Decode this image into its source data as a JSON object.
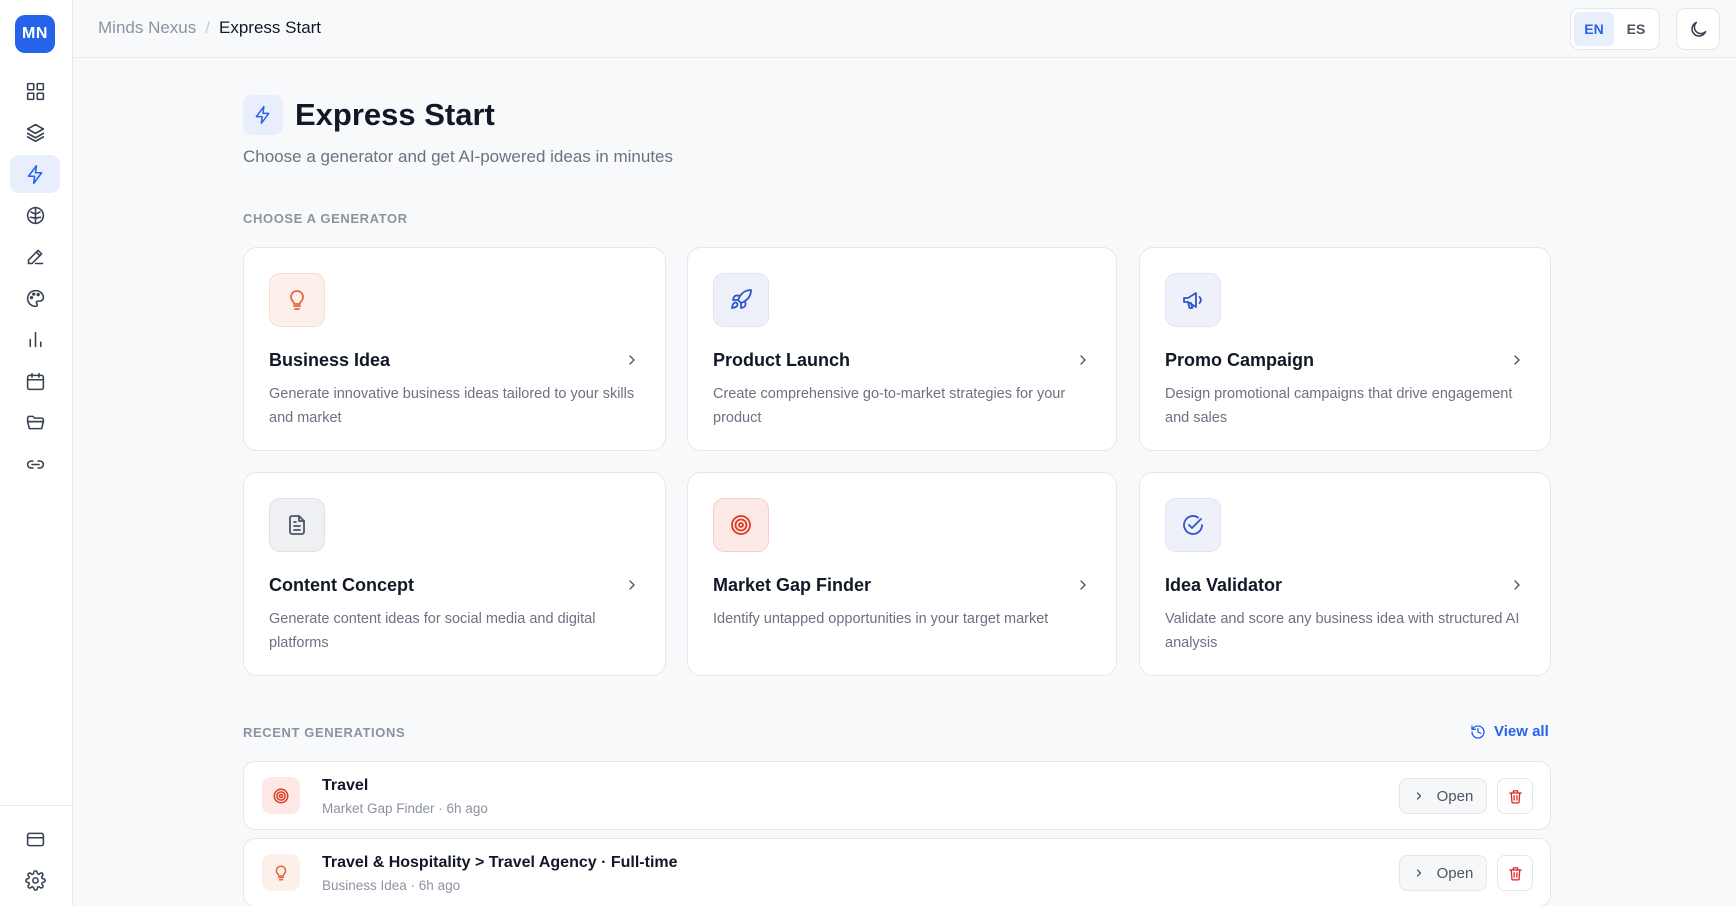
{
  "app": {
    "logo_text": "MN"
  },
  "breadcrumb": {
    "root": "Minds Nexus",
    "separator": "/",
    "current": "Express Start"
  },
  "header": {
    "languages": [
      {
        "code": "EN",
        "active": true
      },
      {
        "code": "ES",
        "active": false
      }
    ],
    "theme_icon": "moon-icon",
    "profile_icon": "user-icon"
  },
  "sidebar": {
    "items": [
      {
        "icon": "grid-icon",
        "active": false
      },
      {
        "icon": "layers-icon",
        "active": false
      },
      {
        "icon": "zap-icon",
        "active": true
      },
      {
        "icon": "brain-icon",
        "active": false
      },
      {
        "icon": "pencil-icon",
        "active": false
      },
      {
        "icon": "palette-icon",
        "active": false
      },
      {
        "icon": "bar-chart-icon",
        "active": false
      },
      {
        "icon": "calendar-icon",
        "active": false
      },
      {
        "icon": "folder-icon",
        "active": false
      },
      {
        "icon": "link-icon",
        "active": false
      }
    ],
    "bottom_items": [
      {
        "icon": "credit-card-icon"
      },
      {
        "icon": "settings-icon"
      }
    ]
  },
  "page": {
    "title": "Express Start",
    "subtitle": "Choose a generator and get AI-powered ideas in minutes",
    "generators_label": "CHOOSE A GENERATOR",
    "recent_label": "RECENT GENERATIONS",
    "view_all": "View all"
  },
  "generators": [
    {
      "title": "Business Idea",
      "description": "Generate innovative business ideas tailored to your skills and market",
      "icon": "lightbulb-icon"
    },
    {
      "title": "Product Launch",
      "description": "Create comprehensive go-to-market strategies for your product",
      "icon": "rocket-icon"
    },
    {
      "title": "Promo Campaign",
      "description": "Design promotional campaigns that drive engagement and sales",
      "icon": "megaphone-icon"
    },
    {
      "title": "Content Concept",
      "description": "Generate content ideas for social media and digital platforms",
      "icon": "file-text-icon"
    },
    {
      "title": "Market Gap Finder",
      "description": "Identify untapped opportunities in your target market",
      "icon": "target-icon"
    },
    {
      "title": "Idea Validator",
      "description": "Validate and score any business idea with structured AI analysis",
      "icon": "check-circle-icon"
    }
  ],
  "recent": [
    {
      "title": "Travel",
      "meta": "Market Gap Finder · 6h ago",
      "icon": "target-icon",
      "open_label": "Open"
    },
    {
      "title": "Travel & Hospitality > Travel Agency · Full-time",
      "meta": "Business Idea · 6h ago",
      "icon": "lightbulb-icon",
      "open_label": "Open"
    }
  ],
  "colors": {
    "accent": "#2563eb",
    "danger": "#dc2626",
    "orange": "#e5673f"
  }
}
